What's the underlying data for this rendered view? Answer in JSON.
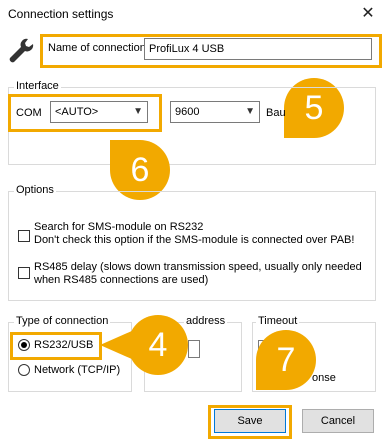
{
  "window": {
    "title": "Connection settings",
    "close_glyph": "✕"
  },
  "connection": {
    "name_label": "Name of connection",
    "name_value": "ProfiLux 4 USB"
  },
  "interface": {
    "group_label": "Interface",
    "com_label": "COM",
    "com_value": "<AUTO>",
    "baud_value": "9600",
    "baud_label_partial": "Bau"
  },
  "options": {
    "group_label": "Options",
    "sms_line1": "Search for SMS-module on RS232",
    "sms_line2": "Don't check this option if the SMS-module is connected over PAB!",
    "rs485_line1": "RS485 delay (slows down transmission speed, usually only needed",
    "rs485_line2": "when RS485 connections are used)"
  },
  "type_of_connection": {
    "group_label": "Type of connection",
    "rs232_label": "RS232/USB",
    "network_label": "Network (TCP/IP)",
    "selected": "RS232/USB"
  },
  "device_address": {
    "group_label_partial": "address"
  },
  "timeout": {
    "group_label": "Timeout",
    "partial_text": "onse"
  },
  "buttons": {
    "save": "Save",
    "cancel": "Cancel"
  },
  "callouts": {
    "c5": "5",
    "c6": "6",
    "c4": "4",
    "c7": "7"
  },
  "colors": {
    "highlight": "#f2a900",
    "focus_blue": "#0078d7"
  },
  "icons": {
    "wrench": "wrench-icon",
    "dropdown": "chevron-down-icon"
  }
}
